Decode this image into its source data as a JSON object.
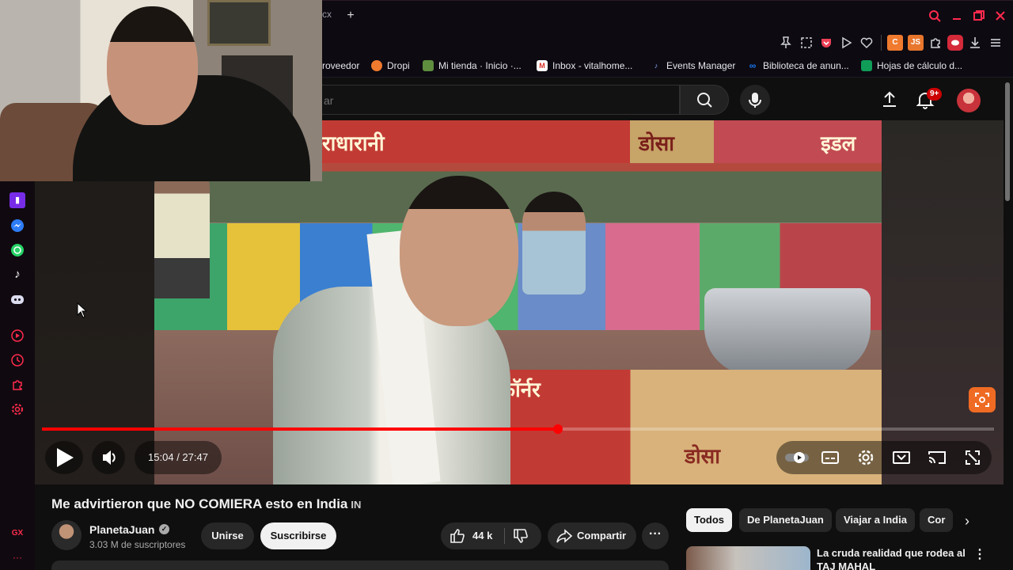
{
  "browser": {
    "tab_partial": "cx",
    "new_tab": "+",
    "bookmarks": [
      {
        "label": "roveedor",
        "icon": "store-icon",
        "color": "#2a6dd8"
      },
      {
        "label": "Dropi",
        "icon": "dropi-icon",
        "color": "#f07a2e"
      },
      {
        "label": "Mi tienda · Inicio ·...",
        "icon": "shopify-icon",
        "color": "#5e8e3e"
      },
      {
        "label": "Inbox - vitalhome...",
        "icon": "gmail-icon",
        "color": "#d93025"
      },
      {
        "label": "Events Manager",
        "icon": "events-icon",
        "color": "#3b5998"
      },
      {
        "label": "Biblioteca de anun...",
        "icon": "meta-icon",
        "color": "#1877f2"
      },
      {
        "label": "Hojas de cálculo d...",
        "icon": "sheets-icon",
        "color": "#0f9d58"
      }
    ],
    "extensions": [
      {
        "label": "C",
        "color": "#f07a2e"
      },
      {
        "label": "JS",
        "color": "#e8762c"
      }
    ]
  },
  "sidebar": {
    "items": [
      "twitch-icon",
      "messenger-icon",
      "whatsapp-icon",
      "tiktok-icon",
      "discord-icon",
      "player-icon",
      "history-icon",
      "extensions-icon",
      "settings-icon"
    ],
    "bottom_label": "GX",
    "more": "···"
  },
  "youtube": {
    "search_placeholder": "ar",
    "notification_count": "9+",
    "accent": "#ff0000"
  },
  "player": {
    "time": "15:04 / 27:47",
    "progress": 0.542,
    "sign_top_left": "राधारानी",
    "sign_top_mid": "डोसा",
    "sign_top_right": "इडल",
    "sign_bottom": "कॉर्नर",
    "sign_bottom_right": "डोसा"
  },
  "video": {
    "title": "Me advirtieron que NO COMIERA esto en India",
    "title_flag": "IN",
    "channel": "PlanetaJuan",
    "subscribers": "3.03 M de suscriptores",
    "join_label": "Unirse",
    "subscribe_label": "Suscribirse",
    "likes": "44 k",
    "share_label": "Compartir"
  },
  "chips": [
    "Todos",
    "De PlanetaJuan",
    "Viajar a India",
    "Cor"
  ],
  "recommendation": {
    "title": "La cruda realidad que rodea al TAJ MAHAL"
  }
}
